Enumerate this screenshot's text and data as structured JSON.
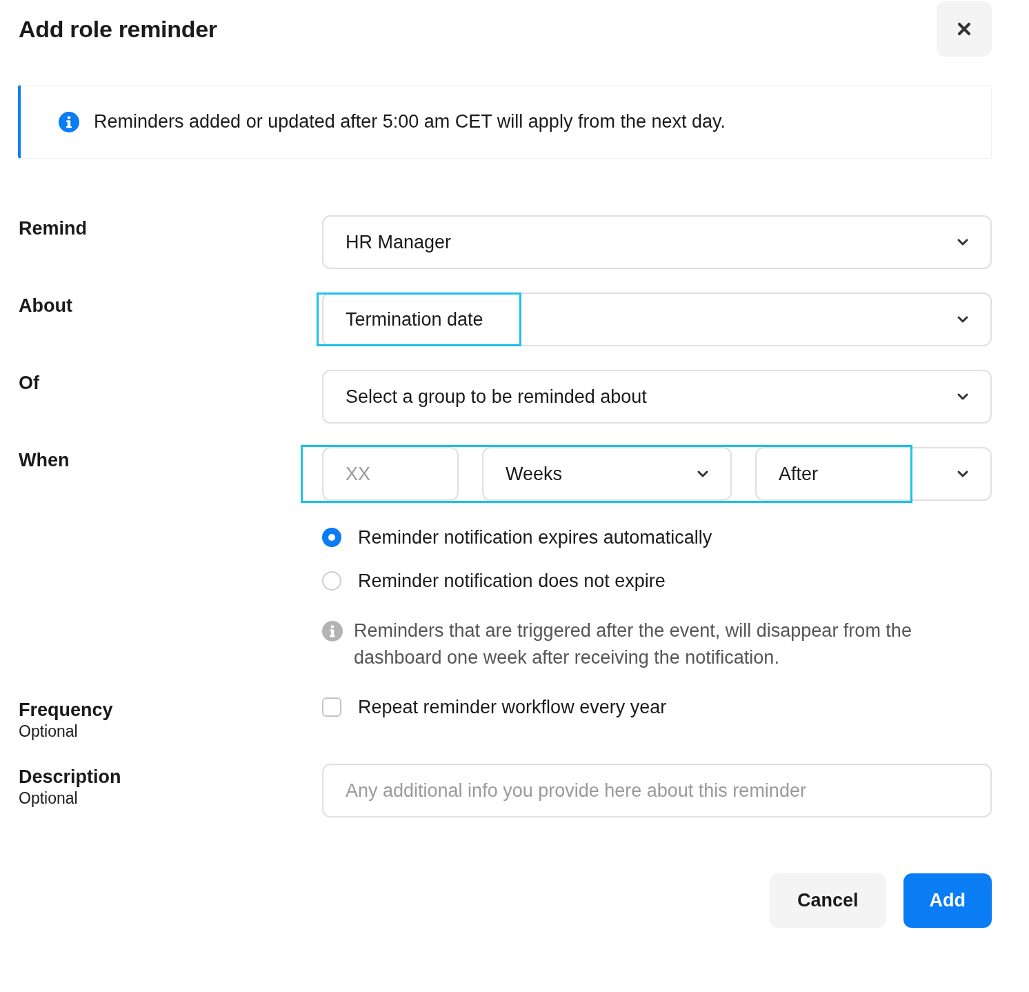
{
  "dialog": {
    "title": "Add role reminder"
  },
  "notice": {
    "text": "Reminders added or updated after 5:00 am CET will apply from the next day."
  },
  "rows": [
    {
      "kind": "select",
      "label": "Remind",
      "value": "HR Manager",
      "highlighted": false
    },
    {
      "kind": "select",
      "label": "About",
      "value": "Termination date",
      "highlighted": true
    },
    {
      "kind": "select",
      "label": "Of",
      "value": "Select a group to be reminded about",
      "highlighted": false
    },
    {
      "kind": "timing",
      "label": "When",
      "amount": {
        "placeholder": "XX"
      },
      "unit": "Weeks",
      "relation": "After",
      "highlighted": true,
      "options": [
        {
          "label": "Reminder notification expires automatically",
          "selected": true
        },
        {
          "label": "Reminder notification does not expire",
          "selected": false
        }
      ],
      "note": "Reminders that are triggered after the event, will disappear from the dashboard one week after receiving the notification."
    },
    {
      "kind": "checkbox",
      "label": "Frequency",
      "hint": "Optional",
      "option": {
        "label": "Repeat reminder workflow every year",
        "checked": false
      }
    },
    {
      "kind": "text",
      "label": "Description",
      "hint": "Optional",
      "placeholder": "Any additional info you provide here about this reminder"
    }
  ],
  "buttons": [
    {
      "label": "Cancel",
      "kind": "secondary"
    },
    {
      "label": "Add",
      "kind": "primary"
    }
  ]
}
